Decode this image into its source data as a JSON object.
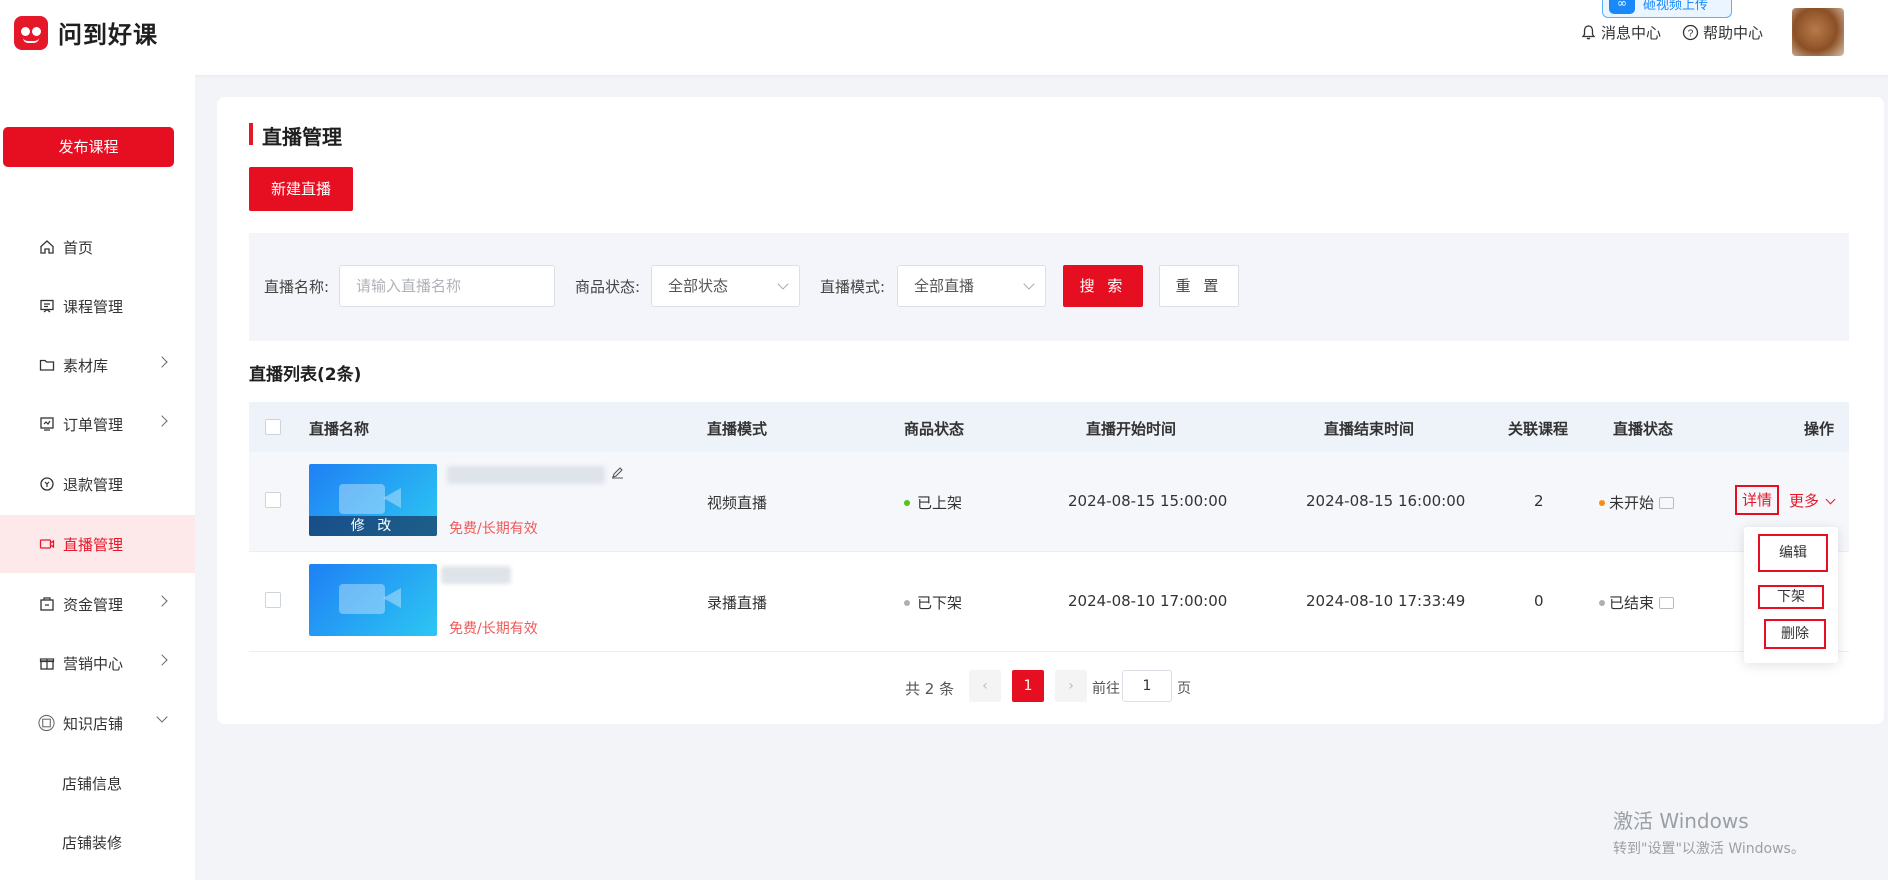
{
  "brand": {
    "name": "问到好课",
    "color": "#e5182a"
  },
  "header": {
    "upload_badge": "砸视频上传",
    "messages": "消息中心",
    "help": "帮助中心"
  },
  "sidebar": {
    "publish": "发布课程",
    "items": [
      {
        "label": "首页",
        "icon": "home-icon"
      },
      {
        "label": "课程管理",
        "icon": "course-icon"
      },
      {
        "label": "素材库",
        "icon": "folder-icon"
      },
      {
        "label": "订单管理",
        "icon": "order-icon"
      },
      {
        "label": "退款管理",
        "icon": "refund-icon"
      },
      {
        "label": "直播管理",
        "icon": "live-icon"
      },
      {
        "label": "资金管理",
        "icon": "wallet-icon"
      },
      {
        "label": "营销中心",
        "icon": "gift-icon"
      },
      {
        "label": "知识店铺",
        "icon": "store-icon"
      },
      {
        "label": "店铺信息"
      },
      {
        "label": "店铺装修"
      }
    ]
  },
  "page": {
    "title": "直播管理",
    "new_button": "新建直播",
    "filters": {
      "name_label": "直播名称:",
      "name_placeholder": "请输入直播名称",
      "status_label": "商品状态:",
      "status_value": "全部状态",
      "mode_label": "直播模式:",
      "mode_value": "全部直播",
      "search": "搜 索",
      "reset": "重 置"
    },
    "list_title": "直播列表(2条)",
    "columns": [
      "直播名称",
      "直播模式",
      "商品状态",
      "直播开始时间",
      "直播结束时间",
      "关联课程",
      "直播状态",
      "操作"
    ],
    "rows": [
      {
        "thumb_label": "修 改",
        "price": "免费/长期有效",
        "mode": "视频直播",
        "product_status": "已上架",
        "start": "2024-08-15 15:00:00",
        "end": "2024-08-15 16:00:00",
        "courses": "2",
        "live_status": "未开始",
        "op_detail": "详情",
        "op_more": "更多"
      },
      {
        "price": "免费/长期有效",
        "mode": "录播直播",
        "product_status": "已下架",
        "start": "2024-08-10 17:00:00",
        "end": "2024-08-10 17:33:49",
        "courses": "0",
        "live_status": "已结束"
      }
    ],
    "more_menu": [
      "编辑",
      "下架",
      "删除"
    ],
    "pagination": {
      "total": "共 2 条",
      "current": "1",
      "goto": "前往",
      "input": "1",
      "unit": "页"
    }
  },
  "watermark": {
    "line1": "激活 Windows",
    "line2": "转到\"设置\"以激活 Windows。"
  },
  "colors": {
    "accent": "#e60f22",
    "on_shelf_dot": "#52c41a",
    "off_shelf_dot": "#b0b0b0",
    "not_started_dot": "#fa8c16",
    "ended_dot": "#b0b0b0"
  }
}
